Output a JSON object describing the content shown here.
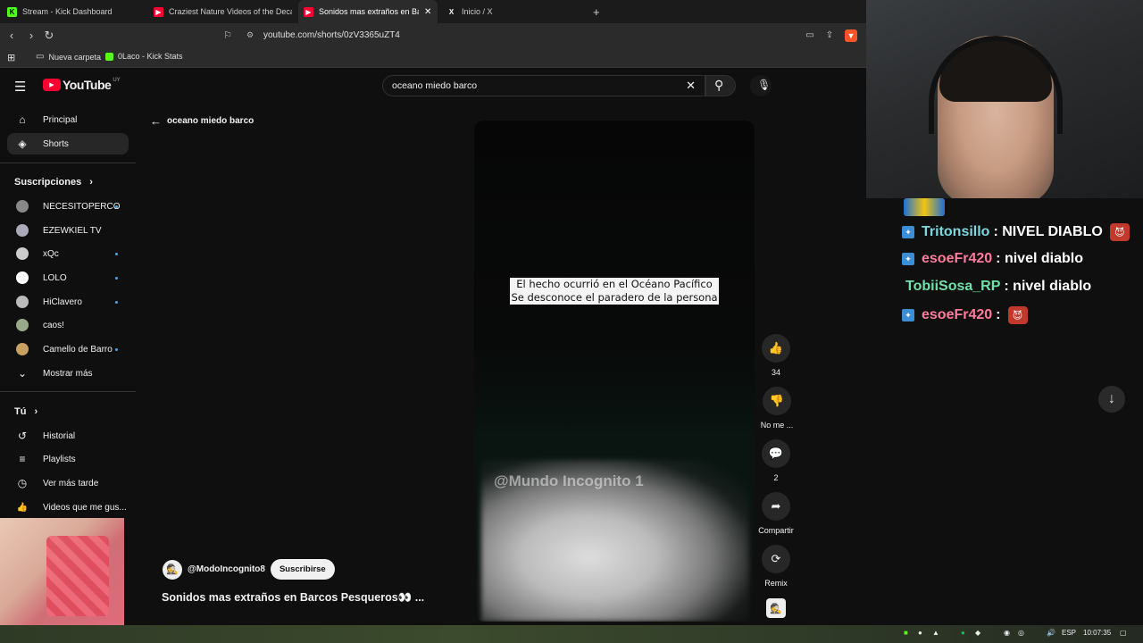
{
  "browser": {
    "tabs": [
      {
        "title": "Stream - Kick Dashboard",
        "icon": "K",
        "color": "#53fc18"
      },
      {
        "title": "Craziest Nature Videos of the Decade",
        "icon": "▶",
        "color": "#ff0033"
      },
      {
        "title": "Sonidos mas extraños en Barc",
        "icon": "▶",
        "color": "#ff0033"
      },
      {
        "title": "Inicio / X",
        "icon": "X",
        "color": "#ffffff"
      }
    ],
    "new_tab": "+",
    "url": "youtube.com/shorts/0zV3365uZT4",
    "bookmarks": [
      "Nueva carpeta",
      "0Laco - Kick Stats"
    ]
  },
  "youtube": {
    "logo": "YouTube",
    "region": "UY",
    "search_value": "oceano miedo barco",
    "back_label": "oceano miedo barco",
    "nav": [
      {
        "label": "Principal",
        "icon": "⌂"
      },
      {
        "label": "Shorts",
        "icon": "◈"
      }
    ],
    "subs_header": "Suscripciones",
    "subscriptions": [
      {
        "name": "NECESITOPERCO",
        "dot": true,
        "color": "#888"
      },
      {
        "name": "EZEWKIEL TV",
        "dot": false,
        "color": "#aab"
      },
      {
        "name": "xQc",
        "dot": true,
        "color": "#ccc"
      },
      {
        "name": "LOLO",
        "dot": true,
        "color": "#fff"
      },
      {
        "name": "HiClavero",
        "dot": true,
        "color": "#bbb"
      },
      {
        "name": "caos!",
        "dot": false,
        "color": "#9a8"
      },
      {
        "name": "Camello de Barro",
        "dot": true,
        "color": "#c8a060"
      }
    ],
    "show_more": "Mostrar más",
    "you_header": "Tú",
    "you_items": [
      {
        "label": "Historial",
        "icon": "↺"
      },
      {
        "label": "Playlists",
        "icon": "≡"
      },
      {
        "label": "Ver más tarde",
        "icon": "◷"
      },
      {
        "label": "Videos que me gus...",
        "icon": "👍"
      }
    ],
    "short": {
      "caption_line1": "El hecho ocurrió en el Océano Pacífico",
      "caption_line2": "Se desconoce el paradero de la persona",
      "watermark": "@Mundo Incognito 1",
      "channel": "@ModoIncognito8",
      "subscribe": "Suscribirse",
      "title": "Sonidos mas extraños en Barcos Pesqueros👀 ..."
    },
    "actions": [
      {
        "label": "34",
        "icon": "👍"
      },
      {
        "label": "No me ...",
        "icon": "👎"
      },
      {
        "label": "2",
        "icon": "💬"
      },
      {
        "label": "Compartir",
        "icon": "➦"
      },
      {
        "label": "Remix",
        "icon": "⟳"
      }
    ]
  },
  "chat": {
    "messages": [
      {
        "user": "Tritonsillo",
        "color": "#7ed6df",
        "badge": true,
        "text": ": NIVEL DIABLO",
        "emote": true
      },
      {
        "user": "esoeFr420",
        "color": "#ff7b9c",
        "badge": true,
        "text": ": nivel diablo",
        "emote": false
      },
      {
        "user": "TobiiSosa_RP",
        "color": "#6ee0a8",
        "badge": false,
        "text": ": nivel diablo",
        "emote": false
      },
      {
        "user": "esoeFr420",
        "color": "#ff7b9c",
        "badge": true,
        "text": ":",
        "emote": true
      }
    ]
  },
  "taskbar": {
    "lang": "ESP",
    "time": "10:07:35"
  }
}
